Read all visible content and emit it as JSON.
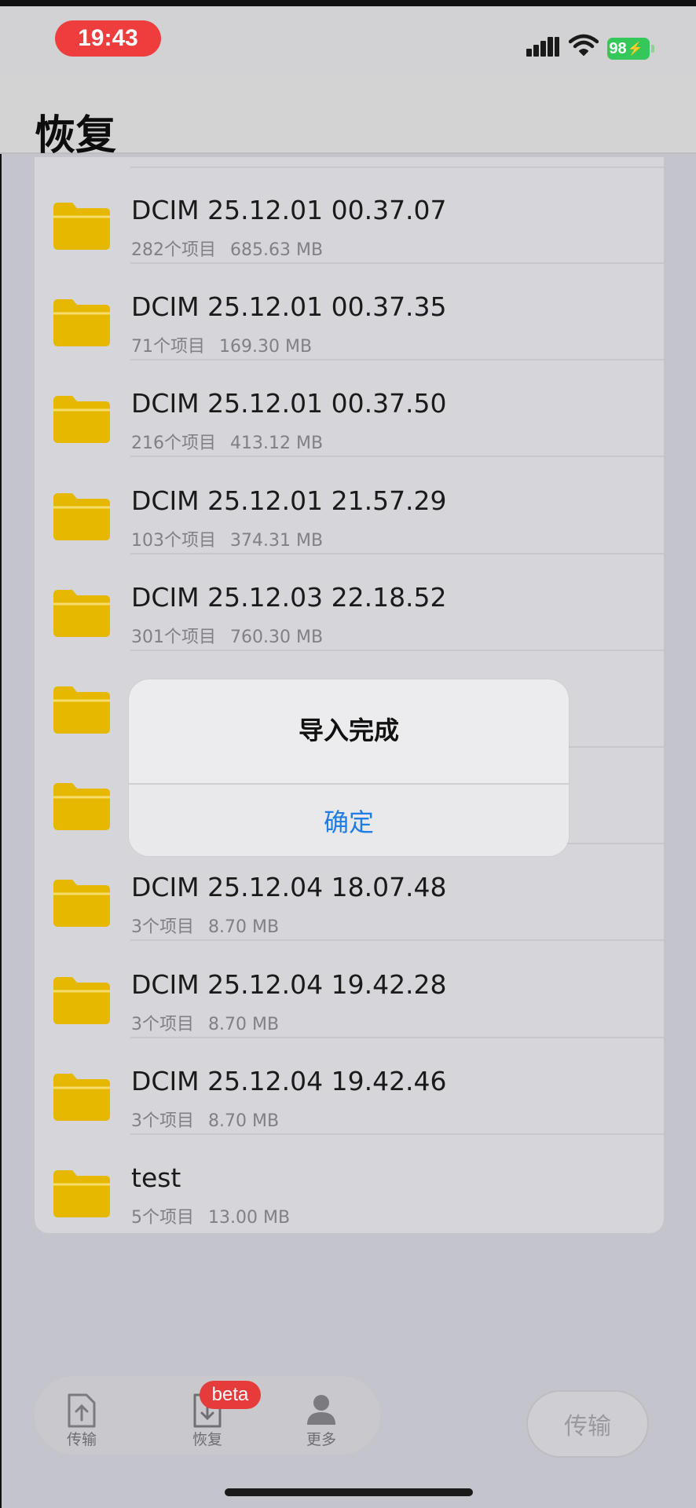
{
  "status_bar": {
    "time": "19:43",
    "battery": "98",
    "battery_color": "#34c759",
    "time_pill_color": "#ef3d3d",
    "icons": [
      "cellular-signal-icon",
      "wifi-icon",
      "battery-icon"
    ]
  },
  "header": {
    "title": "恢复"
  },
  "folder_icon_color": "#e6b800",
  "folders": [
    {
      "name": "DCIM 25.12.01 00.37.07",
      "count": "282个项目",
      "size": "685.63 MB"
    },
    {
      "name": "DCIM 25.12.01 00.37.35",
      "count": "71个项目",
      "size": "169.30 MB"
    },
    {
      "name": "DCIM 25.12.01 00.37.50",
      "count": "216个项目",
      "size": "413.12 MB"
    },
    {
      "name": "DCIM 25.12.01 21.57.29",
      "count": "103个项目",
      "size": "374.31 MB"
    },
    {
      "name": "DCIM 25.12.03 22.18.52",
      "count": "301个项目",
      "size": "760.30 MB"
    },
    {
      "name": "",
      "count": "",
      "size": ""
    },
    {
      "name": "",
      "count": "",
      "size": ""
    },
    {
      "name": "DCIM 25.12.04 18.07.48",
      "count": "3个项目",
      "size": "8.70 MB"
    },
    {
      "name": "DCIM 25.12.04 19.42.28",
      "count": "3个项目",
      "size": "8.70 MB"
    },
    {
      "name": "DCIM 25.12.04 19.42.46",
      "count": "3个项目",
      "size": "8.70 MB"
    },
    {
      "name": "test",
      "count": "5个项目",
      "size": "13.00 MB"
    }
  ],
  "alert": {
    "title": "导入完成",
    "confirm_label": "确定",
    "confirm_color": "#1f7de6"
  },
  "tabbar": {
    "tabs": [
      {
        "label": "传输",
        "icon": "upload-document-icon"
      },
      {
        "label": "恢复",
        "icon": "download-document-icon",
        "badge": "beta"
      },
      {
        "label": "更多",
        "icon": "person-icon"
      }
    ],
    "badge_color": "#e63b3b"
  },
  "transfer_button": {
    "label": "传输"
  }
}
